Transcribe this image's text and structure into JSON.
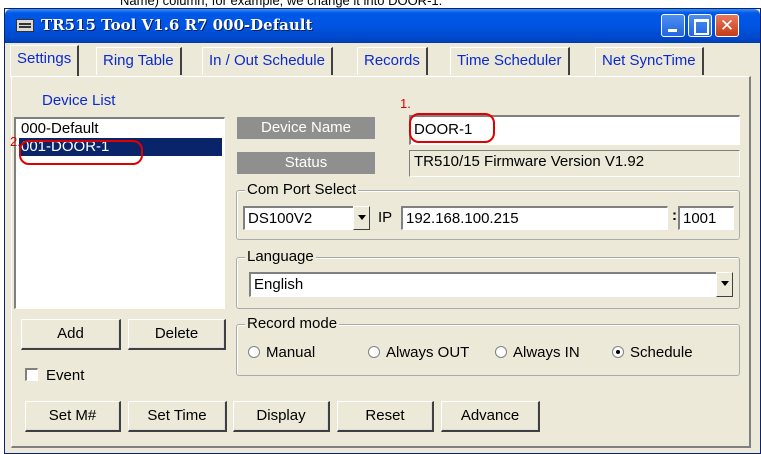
{
  "caption_fragment": "Name) column, for example, we change it into DOOR-1.",
  "window": {
    "title": "TR515 Tool V1.6 R7   000-Default"
  },
  "tabs": [
    "Settings",
    "Ring Table",
    "In / Out Schedule",
    "Records",
    "Time Scheduler",
    "Net SyncTime"
  ],
  "device_list": {
    "label": "Device List",
    "items": [
      "000-Default",
      "001-DOOR-1"
    ],
    "selected_index": 1
  },
  "device_name": {
    "label": "Device Name",
    "value": "DOOR-1"
  },
  "status": {
    "label": "Status",
    "value": "TR510/15 Firmware Version V1.92"
  },
  "com_port": {
    "legend": "Com Port Select",
    "port_value": "DS100V2",
    "ip_label": "IP",
    "ip_value": "192.168.100.215",
    "port_sep": ":",
    "port_number": "1001"
  },
  "language": {
    "legend": "Language",
    "value": "English"
  },
  "record_mode": {
    "legend": "Record mode",
    "options": [
      "Manual",
      "Always OUT",
      "Always IN",
      "Schedule"
    ],
    "selected": "Schedule"
  },
  "list_buttons": {
    "add": "Add",
    "delete": "Delete"
  },
  "event_checkbox": {
    "label": "Event",
    "checked": false
  },
  "bottom_buttons": [
    "Set M#",
    "Set Time",
    "Display",
    "Reset",
    "Advance"
  ],
  "annotations": {
    "one": "1.",
    "two": "2."
  },
  "colors": {
    "titlebar": "#0054e3",
    "face": "#ece9d8",
    "tab_text": "#0a2ad0",
    "selection": "#0a246a",
    "annotation": "#e00000"
  }
}
